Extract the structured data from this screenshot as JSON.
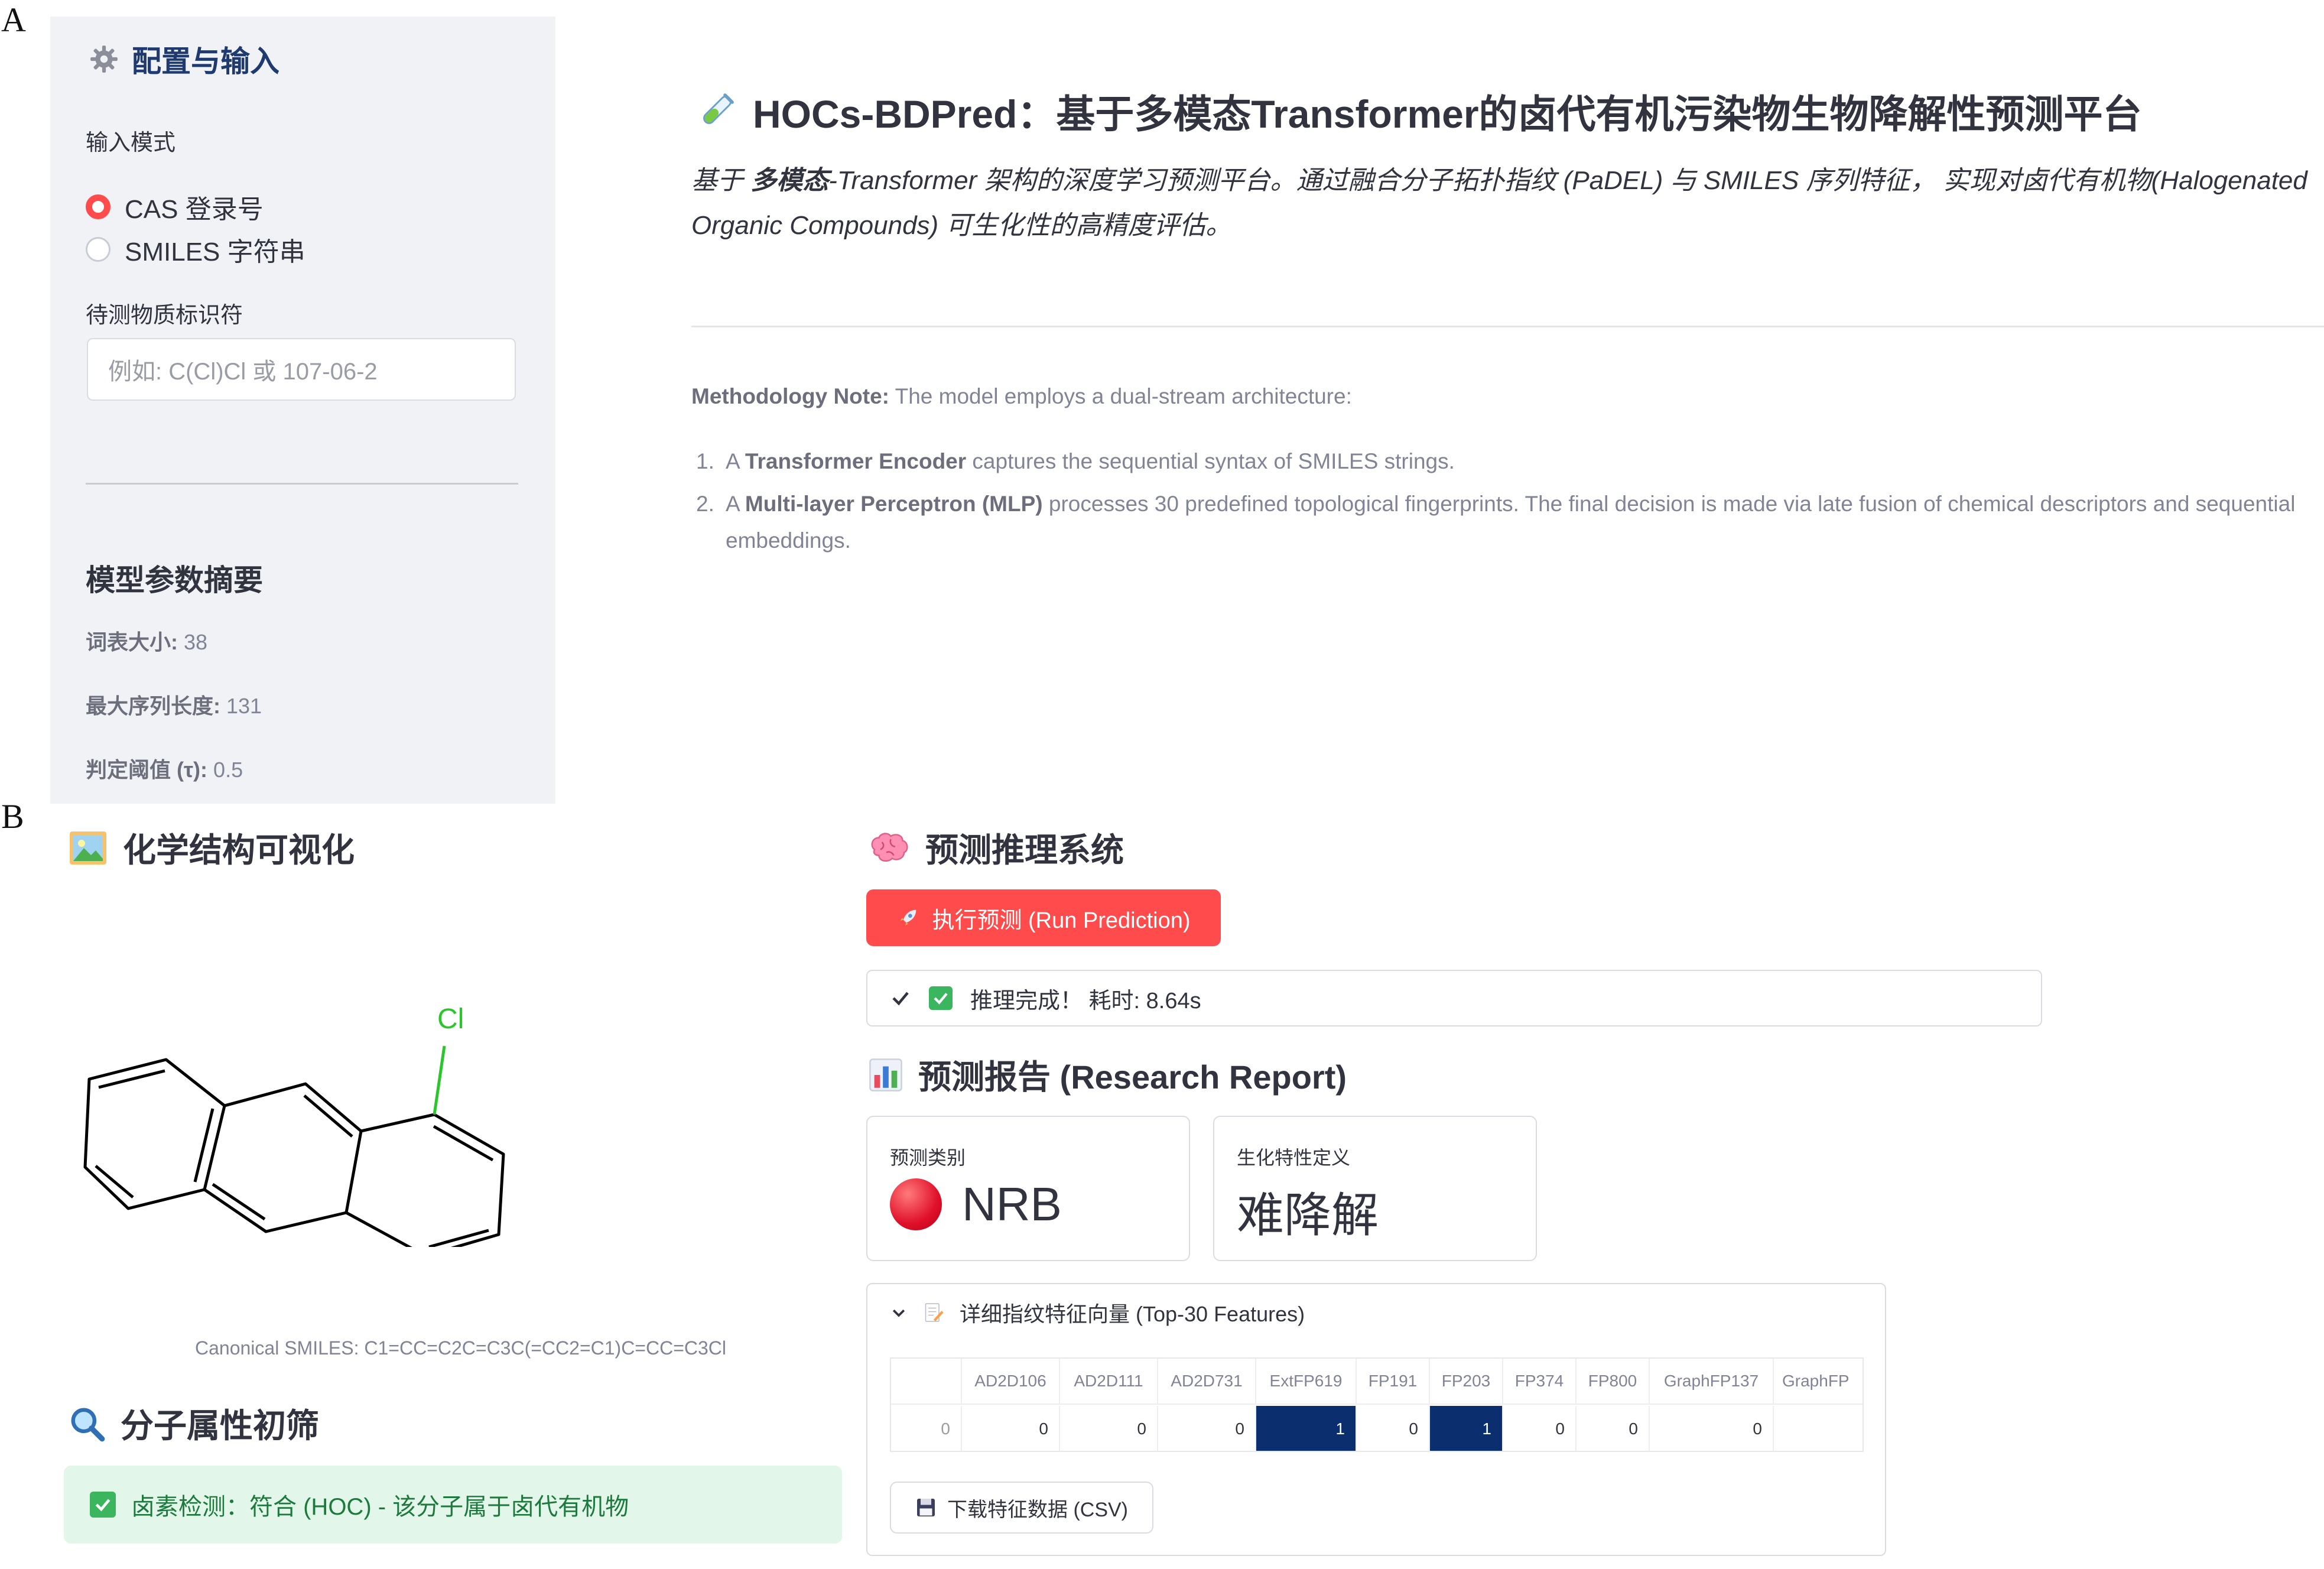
{
  "panel_labels": {
    "a": "A",
    "b": "B"
  },
  "sidebar": {
    "title": "配置与输入",
    "input_mode_label": "输入模式",
    "radio_options": [
      {
        "label": "CAS 登录号",
        "selected": true
      },
      {
        "label": "SMILES 字符串",
        "selected": false
      }
    ],
    "identifier_label": "待测物质标识符",
    "identifier_placeholder": "例如: C(Cl)Cl 或 107-06-2",
    "params_title": "模型参数摘要",
    "params": [
      {
        "key": "词表大小:",
        "value": " 38"
      },
      {
        "key": "最大序列长度:",
        "value": " 131"
      },
      {
        "key": "判定阈值 (τ):",
        "value": " 0.5"
      }
    ]
  },
  "header": {
    "title": "HOCs-BDPred：基于多模态Transformer的卤代有机污染物生物降解性预测平台",
    "description_pre": "基于 ",
    "description_bold": "多模态",
    "description_post": "-Transformer 架构的深度学习预测平台。通过融合分子拓扑指纹 (PaDEL) 与 SMILES 序列特征， 实现对卤代有机物(Halogenated Organic Compounds) 可生化性的高精度评估。",
    "methodology_bold": "Methodology Note:",
    "methodology_text": " The model employs a dual-stream architecture:",
    "list": [
      {
        "num": "1.",
        "pre": "A ",
        "bold": "Transformer Encoder",
        "post": " captures the sequential syntax of SMILES strings."
      },
      {
        "num": "2.",
        "pre": "A ",
        "bold": "Multi-layer Perceptron (MLP)",
        "post": " processes 30 predefined topological fingerprints. The final decision is made via late fusion of chemical descriptors and sequential embeddings."
      }
    ]
  },
  "structure": {
    "title": "化学结构可视化",
    "atom_label": "Cl",
    "smiles_caption": "Canonical SMILES: C1=CC=C2C=C3C(=CC2=C1)C=CC=C3Cl"
  },
  "screening": {
    "title": "分子属性初筛",
    "halogen_result": "卤素检测：符合 (HOC) - 该分子属于卤代有机物"
  },
  "inference": {
    "title": "预测推理系统",
    "run_button": "执行预测 (Run Prediction)",
    "status": "推理完成！ 耗时: 8.64s"
  },
  "report": {
    "title_cn": "预测报告",
    "title_en": " (Research Report)",
    "metric1_label": "预测类别",
    "metric1_value": "NRB",
    "metric2_label": "生化特性定义",
    "metric2_value": "难降解"
  },
  "features": {
    "expander_title": "详细指纹特征向量 (Top-30 Features)",
    "columns": [
      "",
      "AD2D106",
      "AD2D111",
      "AD2D731",
      "ExtFP619",
      "FP191",
      "FP203",
      "FP374",
      "FP800",
      "GraphFP137",
      "GraphFP"
    ],
    "row": [
      "0",
      "0",
      "0",
      "0",
      "1",
      "0",
      "1",
      "0",
      "0",
      "0",
      ""
    ],
    "highlight_color": "#0b2f6e",
    "download_button": "下载特征数据 (CSV)"
  },
  "colors": {
    "accent": "#ff4b4b",
    "sidebar_bg": "#f0f2f6",
    "success_bg": "#e3f6ea",
    "success_text": "#1d7a3d",
    "cl_green": "#2bc62b"
  }
}
